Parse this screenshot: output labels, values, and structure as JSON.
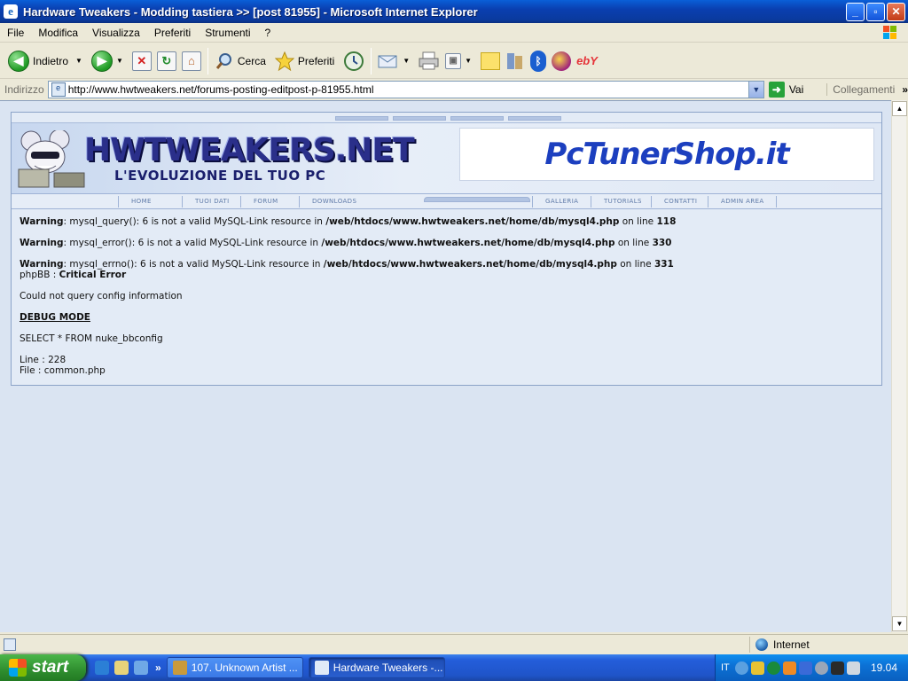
{
  "window": {
    "title": "Hardware Tweakers - Modding tastiera >> [post 81955] - Microsoft Internet Explorer",
    "buttons": {
      "minimize": "_",
      "maximize": "▫",
      "close": "✕"
    }
  },
  "menubar": {
    "items": [
      "File",
      "Modifica",
      "Visualizza",
      "Preferiti",
      "Strumenti",
      "?"
    ]
  },
  "toolbar": {
    "back_label": "Indietro",
    "search_label": "Cerca",
    "favorites_label": "Preferiti",
    "ebay_label": "ebY"
  },
  "address": {
    "label": "Indirizzo",
    "url": "http://www.hwtweakers.net/forums-posting-editpost-p-81955.html",
    "go_label": "Vai",
    "links_label": "Collegamenti",
    "more": "»"
  },
  "site": {
    "logo": "HWTWEAKERS.NET",
    "slogan": "L'EVOLUZIONE DEL TUO PC",
    "banner": "PcTunerShop.it",
    "nav_left": [
      "HOME",
      "TUOI DATI",
      "FORUM",
      "DOWNLOADS"
    ],
    "nav_right": [
      "GALLERIA",
      "TUTORIALS",
      "CONTATTI",
      "ADMIN AREA"
    ]
  },
  "errors": [
    {
      "label": "Warning",
      "text": ": mysql_query(): 6 is not a valid MySQL-Link resource in ",
      "path": "/web/htdocs/www.hwtweakers.net/home/db/mysql4.php",
      "online": " on line ",
      "line": "118"
    },
    {
      "label": "Warning",
      "text": ": mysql_error(): 6 is not a valid MySQL-Link resource in ",
      "path": "/web/htdocs/www.hwtweakers.net/home/db/mysql4.php",
      "online": " on line ",
      "line": "330"
    },
    {
      "label": "Warning",
      "text": ": mysql_errno(): 6 is not a valid MySQL-Link resource in ",
      "path": "/web/htdocs/www.hwtweakers.net/home/db/mysql4.php",
      "online": " on line ",
      "line": "331"
    }
  ],
  "critical": {
    "prefix": "phpBB : ",
    "label": "Critical Error"
  },
  "message": "Could not query config information",
  "debug": {
    "title": "DEBUG MODE",
    "sql": "SELECT * FROM nuke_bbconfig",
    "line": "Line : 228",
    "file": "File : common.php"
  },
  "status": {
    "zone": "Internet"
  },
  "taskbar": {
    "start": "start",
    "quicklaunch_more": "»",
    "tasks": [
      "107. Unknown Artist ...",
      "Hardware Tweakers -..."
    ],
    "lang": "IT",
    "clock": "19.04"
  },
  "colors": {
    "titlebar": "#0a3fb0",
    "content_bg": "#dae4f2",
    "start_green": "#2f8e2f"
  }
}
